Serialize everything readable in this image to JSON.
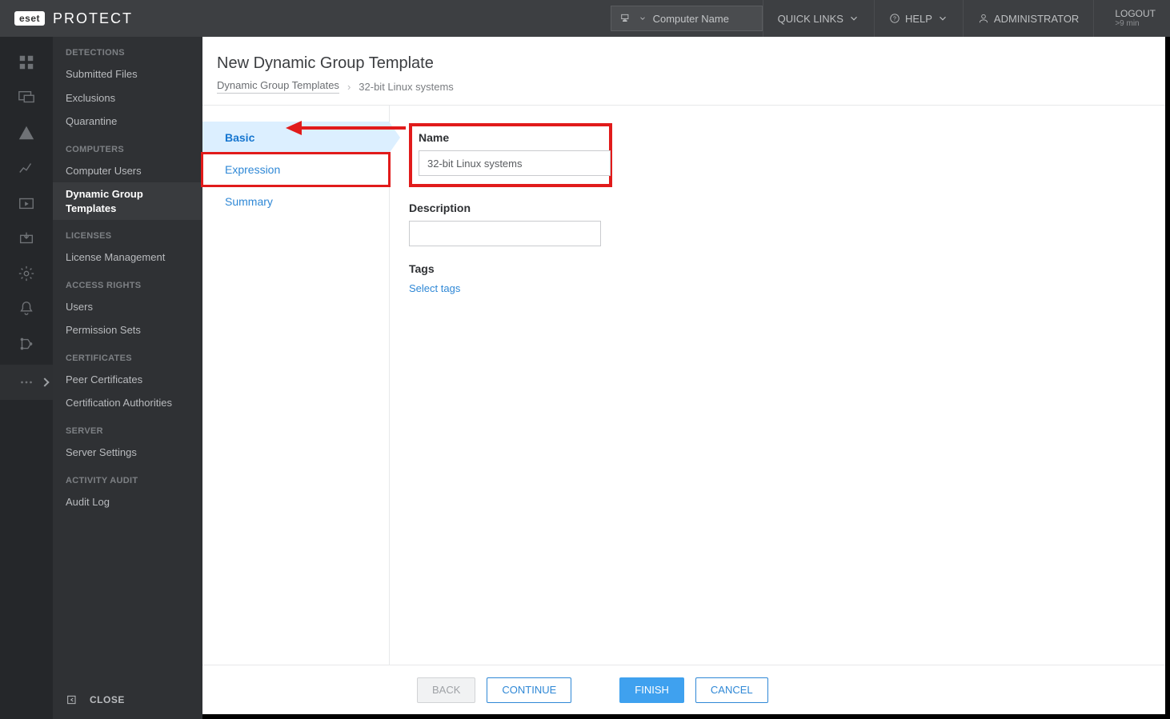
{
  "brand": {
    "badge": "eset",
    "text": "PROTECT"
  },
  "top": {
    "search_placeholder": "Computer Name",
    "quick_links": "QUICK LINKS",
    "help": "HELP",
    "admin": "ADMINISTRATOR",
    "logout": "LOGOUT",
    "logout_sub": ">9 min"
  },
  "sidebar": {
    "sections": [
      {
        "title": "DETECTIONS",
        "items": [
          "Submitted Files",
          "Exclusions",
          "Quarantine"
        ]
      },
      {
        "title": "COMPUTERS",
        "items": [
          "Computer Users",
          "Dynamic Group Templates"
        ]
      },
      {
        "title": "LICENSES",
        "items": [
          "License Management"
        ]
      },
      {
        "title": "ACCESS RIGHTS",
        "items": [
          "Users",
          "Permission Sets"
        ]
      },
      {
        "title": "CERTIFICATES",
        "items": [
          "Peer Certificates",
          "Certification Authorities"
        ]
      },
      {
        "title": "SERVER",
        "items": [
          "Server Settings"
        ]
      },
      {
        "title": "ACTIVITY AUDIT",
        "items": [
          "Audit Log"
        ]
      }
    ],
    "close": "CLOSE",
    "active": "Dynamic Group Templates"
  },
  "page": {
    "title": "New Dynamic Group Template",
    "crumb_link": "Dynamic Group Templates",
    "crumb_current": "32-bit Linux systems"
  },
  "steps": {
    "basic": "Basic",
    "expression": "Expression",
    "summary": "Summary"
  },
  "form": {
    "name_label": "Name",
    "name_value": "32-bit Linux systems",
    "desc_label": "Description",
    "desc_value": "",
    "tags_label": "Tags",
    "tags_link": "Select tags"
  },
  "buttons": {
    "back": "BACK",
    "continue": "CONTINUE",
    "finish": "FINISH",
    "cancel": "CANCEL"
  }
}
